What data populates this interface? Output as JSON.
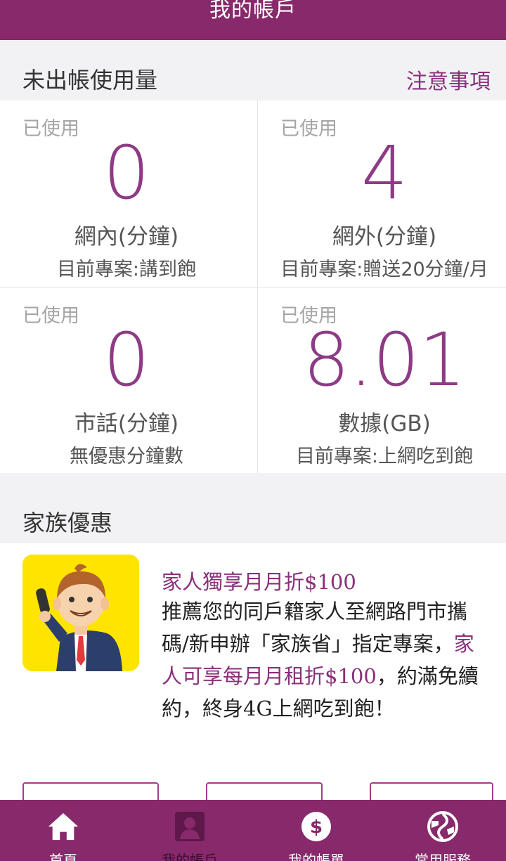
{
  "header": {
    "title": "我的帳戶"
  },
  "usage_section": {
    "title": "未出帳使用量",
    "notice_link": "注意事項",
    "cells": [
      {
        "used_label": "已使用",
        "value": "0",
        "label": "網內(分鐘)",
        "plan": "目前專案:講到飽"
      },
      {
        "used_label": "已使用",
        "value": "4",
        "label": "網外(分鐘)",
        "plan": "目前專案:贈送20分鐘/月"
      },
      {
        "used_label": "已使用",
        "value": "0",
        "label": "市話(分鐘)",
        "plan": "無優惠分鐘數"
      },
      {
        "used_label": "已使用",
        "value": "8.01",
        "label": "數據(GB)",
        "plan": "目前專案:上網吃到飽"
      }
    ]
  },
  "family_section": {
    "title": "家族優惠",
    "promo_heading": "家人獨享月月折$100",
    "promo_body_1": "推薦您的同戶籍家人至網路門市攜碼/新申辦「家族省」指定專案，",
    "promo_body_highlight": "家人可享每月月租折$100",
    "promo_body_2": "，約滿免續約，終身4G上網吃到飽！"
  },
  "tabbar": {
    "items": [
      {
        "label": "首頁",
        "icon": "home-icon"
      },
      {
        "label": "我的帳戶",
        "icon": "account-icon"
      },
      {
        "label": "我的帳單",
        "icon": "dollar-icon"
      },
      {
        "label": "常用服務",
        "icon": "globe-service-icon"
      }
    ],
    "active_index": 1
  },
  "colors": {
    "brand": "#87296a",
    "accent": "#8e3b85",
    "mascot_background": "#ffe400"
  }
}
